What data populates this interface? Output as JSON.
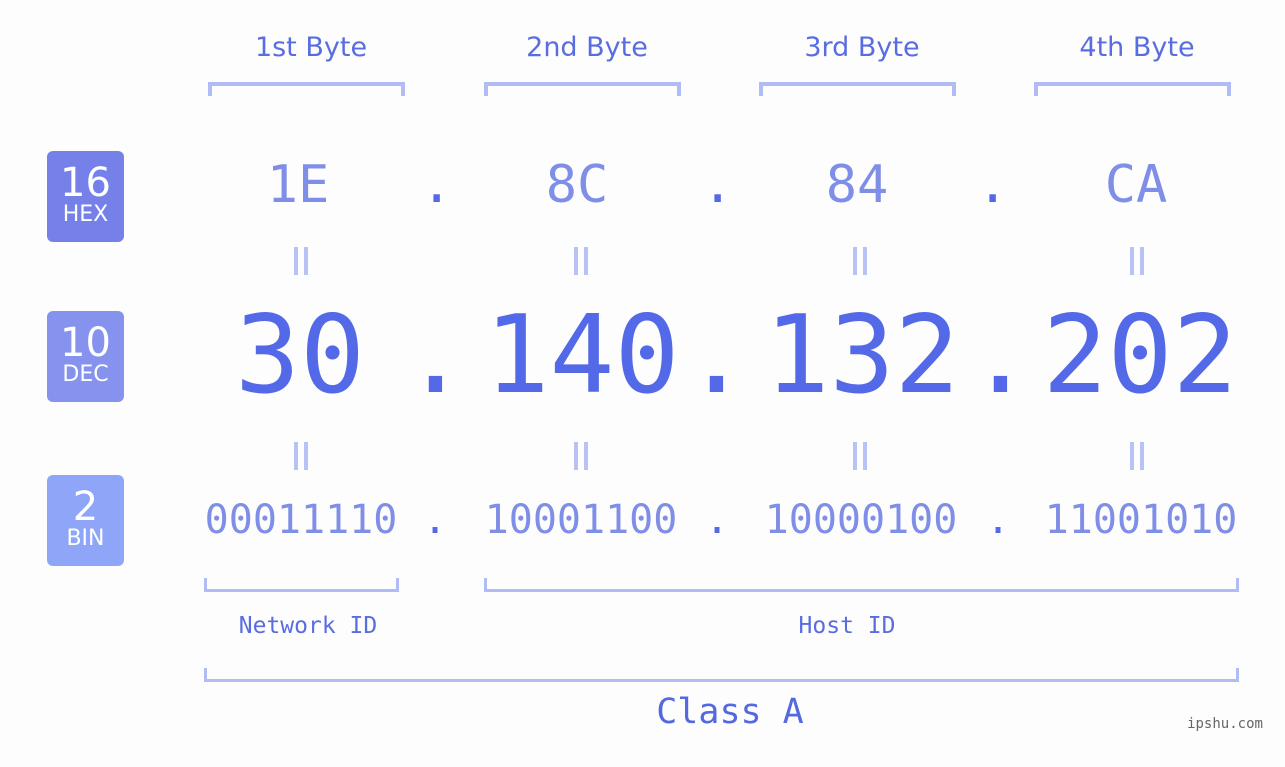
{
  "bytes": [
    {
      "label": "1st Byte",
      "hex": "1E",
      "dec": "30",
      "bin": "00011110"
    },
    {
      "label": "2nd Byte",
      "hex": "8C",
      "dec": "140",
      "bin": "10001100"
    },
    {
      "label": "3rd Byte",
      "hex": "84",
      "dec": "132",
      "bin": "10000100"
    },
    {
      "label": "4th Byte",
      "hex": "CA",
      "dec": "202",
      "bin": "11001010"
    }
  ],
  "separator": ".",
  "badges": {
    "hex": {
      "number": "16",
      "label": "HEX",
      "color": "#7580e8"
    },
    "dec": {
      "number": "10",
      "label": "DEC",
      "color": "#8592ee"
    },
    "bin": {
      "number": "2",
      "label": "BIN",
      "color": "#8fa6f8"
    }
  },
  "parts": {
    "network": "Network ID",
    "host": "Host ID"
  },
  "ip_class": "Class A",
  "watermark": "ipshu.com",
  "colors": {
    "heading": "#5a6de0",
    "hex_text": "#7f8ee6",
    "dec_text": "#5469e8",
    "bracket": "#b1bcf6",
    "background": "#fcfdfc"
  }
}
